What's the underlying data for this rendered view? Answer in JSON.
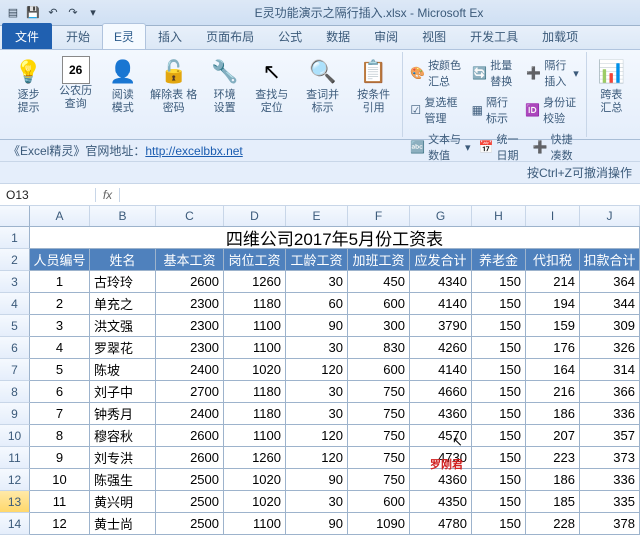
{
  "titlebar": {
    "title": "E灵功能演示之隔行插入.xlsx - Microsoft Ex"
  },
  "tabs": {
    "file": "文件",
    "items": [
      "开始",
      "E灵",
      "插入",
      "页面布局",
      "公式",
      "数据",
      "审阅",
      "视图",
      "开发工具",
      "加载项"
    ],
    "active": 1
  },
  "ribbon": {
    "g1": {
      "b1": "逐步\n提示",
      "b2": "公农历\n查询",
      "b3": "阅读\n模式",
      "b4": "解除表\n格密码",
      "b5": "环境\n设置",
      "b6": "查找与\n定位",
      "b7": "查词并\n标示",
      "b8": "按条件\n引用"
    },
    "g2": {
      "r1": {
        "a": "按颜色汇总",
        "b": "批量替换",
        "c": "隔行插入"
      },
      "r2": {
        "a": "复选框管理",
        "b": "隔行标示",
        "c": "身份证校验"
      },
      "r3": {
        "a": "文本与数值",
        "b": "统一日期",
        "c": "快捷凑数"
      }
    },
    "g3": {
      "lbl": "跨表\n汇总"
    }
  },
  "infobar1_label": "《Excel精灵》官网地址：",
  "infobar1_link": "http://excelbbx.net",
  "infobar2": "按Ctrl+Z可撤消操作",
  "namebox": "O13",
  "fx": "fx",
  "cols": [
    "A",
    "B",
    "C",
    "D",
    "E",
    "F",
    "G",
    "H",
    "I",
    "J"
  ],
  "title_row": "四维公司2017年5月份工资表",
  "headers": [
    "人员编号",
    "姓名",
    "基本工资",
    "岗位工资",
    "工龄工资",
    "加班工资",
    "应发合计",
    "养老金",
    "代扣税",
    "扣款合计"
  ],
  "rows": [
    [
      "1",
      "古玲玲",
      "2600",
      "1260",
      "30",
      "450",
      "4340",
      "150",
      "214",
      "364"
    ],
    [
      "2",
      "单充之",
      "2300",
      "1180",
      "60",
      "600",
      "4140",
      "150",
      "194",
      "344"
    ],
    [
      "3",
      "洪文强",
      "2300",
      "1100",
      "90",
      "300",
      "3790",
      "150",
      "159",
      "309"
    ],
    [
      "4",
      "罗翠花",
      "2300",
      "1100",
      "30",
      "830",
      "4260",
      "150",
      "176",
      "326"
    ],
    [
      "5",
      "陈坡",
      "2400",
      "1020",
      "120",
      "600",
      "4140",
      "150",
      "164",
      "314"
    ],
    [
      "6",
      "刘子中",
      "2700",
      "1180",
      "30",
      "750",
      "4660",
      "150",
      "216",
      "366"
    ],
    [
      "7",
      "钟秀月",
      "2400",
      "1180",
      "30",
      "750",
      "4360",
      "150",
      "186",
      "336"
    ],
    [
      "8",
      "穆容秋",
      "2600",
      "1100",
      "120",
      "750",
      "4570",
      "150",
      "207",
      "357"
    ],
    [
      "9",
      "刘专洪",
      "2600",
      "1260",
      "120",
      "750",
      "4730",
      "150",
      "223",
      "373"
    ],
    [
      "10",
      "陈强生",
      "2500",
      "1020",
      "90",
      "750",
      "4360",
      "150",
      "186",
      "336"
    ],
    [
      "11",
      "黄兴明",
      "2500",
      "1020",
      "30",
      "600",
      "4350",
      "150",
      "185",
      "335"
    ],
    [
      "12",
      "黄士尚",
      "2500",
      "1100",
      "90",
      "1090",
      "4780",
      "150",
      "228",
      "378"
    ]
  ],
  "selected_row": 13,
  "annotation": "罗刚君"
}
